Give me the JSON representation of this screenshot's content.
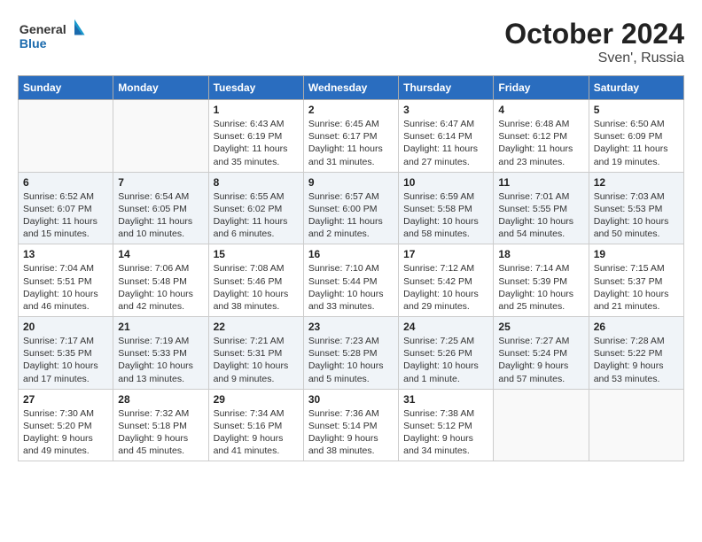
{
  "header": {
    "logo_general": "General",
    "logo_blue": "Blue",
    "month": "October 2024",
    "location": "Sven', Russia"
  },
  "weekdays": [
    "Sunday",
    "Monday",
    "Tuesday",
    "Wednesday",
    "Thursday",
    "Friday",
    "Saturday"
  ],
  "weeks": [
    [
      {
        "day": "",
        "info": ""
      },
      {
        "day": "",
        "info": ""
      },
      {
        "day": "1",
        "info": "Sunrise: 6:43 AM\nSunset: 6:19 PM\nDaylight: 11 hours and 35 minutes."
      },
      {
        "day": "2",
        "info": "Sunrise: 6:45 AM\nSunset: 6:17 PM\nDaylight: 11 hours and 31 minutes."
      },
      {
        "day": "3",
        "info": "Sunrise: 6:47 AM\nSunset: 6:14 PM\nDaylight: 11 hours and 27 minutes."
      },
      {
        "day": "4",
        "info": "Sunrise: 6:48 AM\nSunset: 6:12 PM\nDaylight: 11 hours and 23 minutes."
      },
      {
        "day": "5",
        "info": "Sunrise: 6:50 AM\nSunset: 6:09 PM\nDaylight: 11 hours and 19 minutes."
      }
    ],
    [
      {
        "day": "6",
        "info": "Sunrise: 6:52 AM\nSunset: 6:07 PM\nDaylight: 11 hours and 15 minutes."
      },
      {
        "day": "7",
        "info": "Sunrise: 6:54 AM\nSunset: 6:05 PM\nDaylight: 11 hours and 10 minutes."
      },
      {
        "day": "8",
        "info": "Sunrise: 6:55 AM\nSunset: 6:02 PM\nDaylight: 11 hours and 6 minutes."
      },
      {
        "day": "9",
        "info": "Sunrise: 6:57 AM\nSunset: 6:00 PM\nDaylight: 11 hours and 2 minutes."
      },
      {
        "day": "10",
        "info": "Sunrise: 6:59 AM\nSunset: 5:58 PM\nDaylight: 10 hours and 58 minutes."
      },
      {
        "day": "11",
        "info": "Sunrise: 7:01 AM\nSunset: 5:55 PM\nDaylight: 10 hours and 54 minutes."
      },
      {
        "day": "12",
        "info": "Sunrise: 7:03 AM\nSunset: 5:53 PM\nDaylight: 10 hours and 50 minutes."
      }
    ],
    [
      {
        "day": "13",
        "info": "Sunrise: 7:04 AM\nSunset: 5:51 PM\nDaylight: 10 hours and 46 minutes."
      },
      {
        "day": "14",
        "info": "Sunrise: 7:06 AM\nSunset: 5:48 PM\nDaylight: 10 hours and 42 minutes."
      },
      {
        "day": "15",
        "info": "Sunrise: 7:08 AM\nSunset: 5:46 PM\nDaylight: 10 hours and 38 minutes."
      },
      {
        "day": "16",
        "info": "Sunrise: 7:10 AM\nSunset: 5:44 PM\nDaylight: 10 hours and 33 minutes."
      },
      {
        "day": "17",
        "info": "Sunrise: 7:12 AM\nSunset: 5:42 PM\nDaylight: 10 hours and 29 minutes."
      },
      {
        "day": "18",
        "info": "Sunrise: 7:14 AM\nSunset: 5:39 PM\nDaylight: 10 hours and 25 minutes."
      },
      {
        "day": "19",
        "info": "Sunrise: 7:15 AM\nSunset: 5:37 PM\nDaylight: 10 hours and 21 minutes."
      }
    ],
    [
      {
        "day": "20",
        "info": "Sunrise: 7:17 AM\nSunset: 5:35 PM\nDaylight: 10 hours and 17 minutes."
      },
      {
        "day": "21",
        "info": "Sunrise: 7:19 AM\nSunset: 5:33 PM\nDaylight: 10 hours and 13 minutes."
      },
      {
        "day": "22",
        "info": "Sunrise: 7:21 AM\nSunset: 5:31 PM\nDaylight: 10 hours and 9 minutes."
      },
      {
        "day": "23",
        "info": "Sunrise: 7:23 AM\nSunset: 5:28 PM\nDaylight: 10 hours and 5 minutes."
      },
      {
        "day": "24",
        "info": "Sunrise: 7:25 AM\nSunset: 5:26 PM\nDaylight: 10 hours and 1 minute."
      },
      {
        "day": "25",
        "info": "Sunrise: 7:27 AM\nSunset: 5:24 PM\nDaylight: 9 hours and 57 minutes."
      },
      {
        "day": "26",
        "info": "Sunrise: 7:28 AM\nSunset: 5:22 PM\nDaylight: 9 hours and 53 minutes."
      }
    ],
    [
      {
        "day": "27",
        "info": "Sunrise: 7:30 AM\nSunset: 5:20 PM\nDaylight: 9 hours and 49 minutes."
      },
      {
        "day": "28",
        "info": "Sunrise: 7:32 AM\nSunset: 5:18 PM\nDaylight: 9 hours and 45 minutes."
      },
      {
        "day": "29",
        "info": "Sunrise: 7:34 AM\nSunset: 5:16 PM\nDaylight: 9 hours and 41 minutes."
      },
      {
        "day": "30",
        "info": "Sunrise: 7:36 AM\nSunset: 5:14 PM\nDaylight: 9 hours and 38 minutes."
      },
      {
        "day": "31",
        "info": "Sunrise: 7:38 AM\nSunset: 5:12 PM\nDaylight: 9 hours and 34 minutes."
      },
      {
        "day": "",
        "info": ""
      },
      {
        "day": "",
        "info": ""
      }
    ]
  ]
}
